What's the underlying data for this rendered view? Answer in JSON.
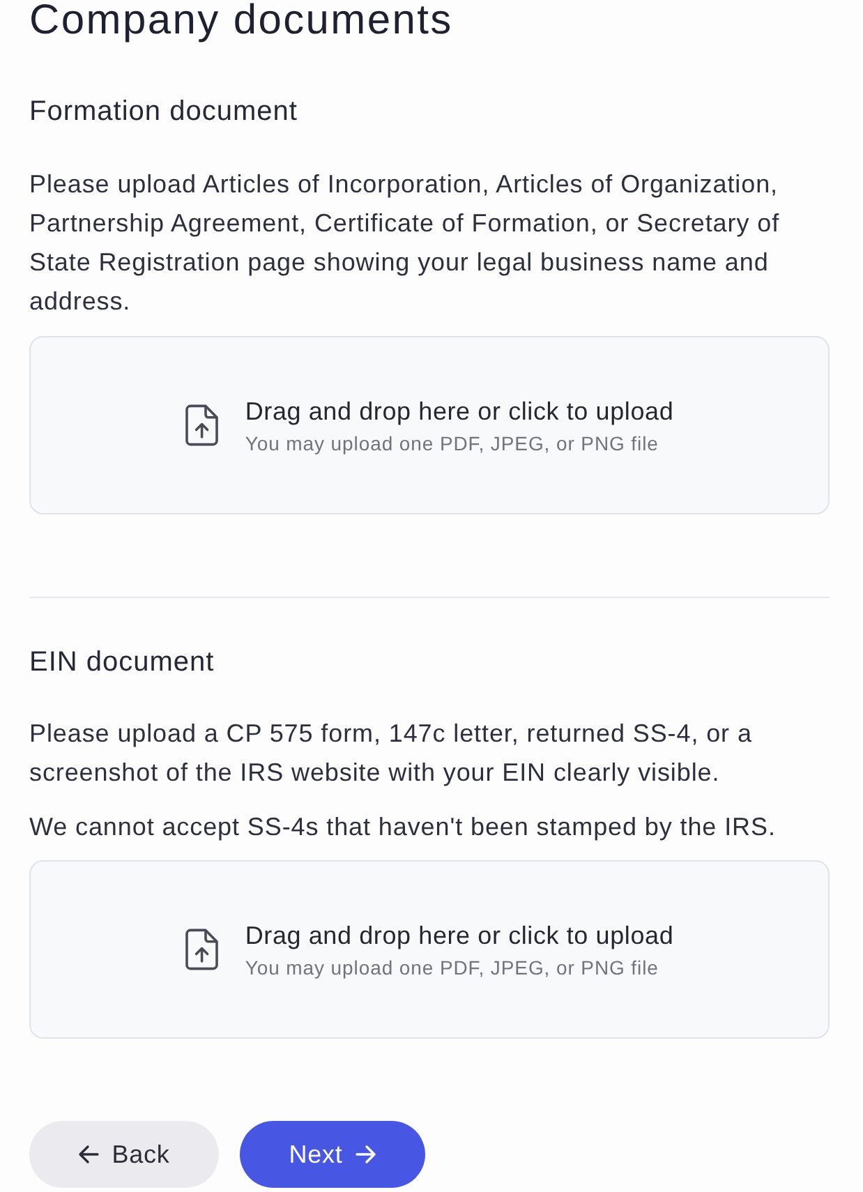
{
  "title": "Company documents",
  "sections": [
    {
      "heading": "Formation document",
      "paragraphs": [
        "Please upload Articles of Incorporation, Articles of Organization, Partnership Agreement, Certificate of Formation, or Secretary of State Registration page showing your legal business name and address."
      ],
      "dropzone": {
        "title": "Drag and drop here or click to upload",
        "hint": "You may upload one PDF, JPEG, or PNG file"
      }
    },
    {
      "heading": "EIN document",
      "paragraphs": [
        "Please upload a CP 575 form, 147c letter, returned SS-4, or a screenshot of the IRS website with your EIN clearly visible.",
        "We cannot accept SS-4s that haven't been stamped by the IRS."
      ],
      "dropzone": {
        "title": "Drag and drop here or click to upload",
        "hint": "You may upload one PDF, JPEG, or PNG file"
      }
    }
  ],
  "buttons": [
    {
      "label": "Back",
      "kind": "back"
    },
    {
      "label": "Next",
      "kind": "next"
    }
  ]
}
